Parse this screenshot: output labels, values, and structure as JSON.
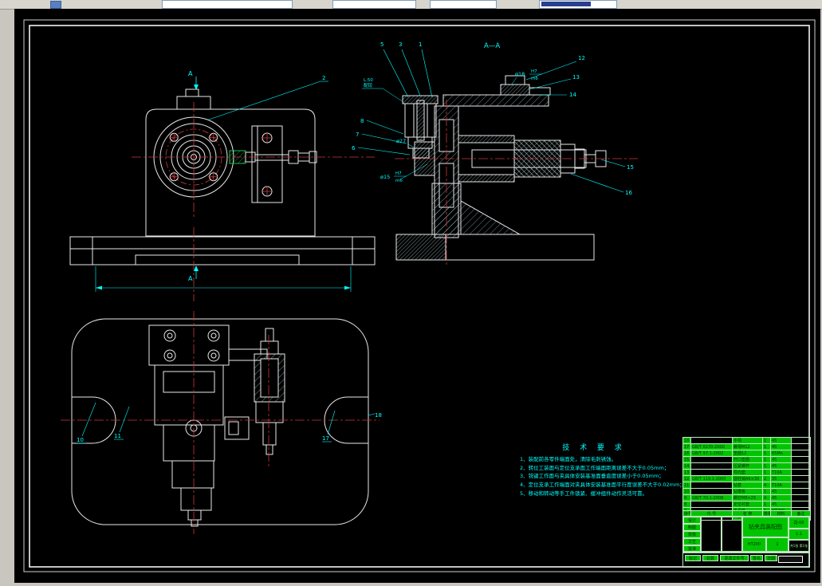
{
  "toolbar": {
    "combos": [
      "",
      "",
      "",
      ""
    ]
  },
  "drawing": {
    "section_label": "A—A",
    "cut_arrow": "A",
    "dims": {
      "d18": "ø18",
      "d18_fit_top": "H7",
      "d18_fit_bot": "m6",
      "d27": "ø27",
      "d15": "ø15",
      "d15_fit_top": "H7",
      "d15_fit_bot": "m6",
      "note_line1": "L:50",
      "note_line2": "配铰"
    },
    "balloons": {
      "b1": "1",
      "b2": "2",
      "b3": "3",
      "b5": "5",
      "b6": "6",
      "b7": "7",
      "b8": "8",
      "b10": "10",
      "b11": "11",
      "b12": "12",
      "b13": "13",
      "b14": "14",
      "b15": "15",
      "b16": "16",
      "b17": "17",
      "b18": "18"
    },
    "tech_req": {
      "title": "技 术 要 求",
      "items": [
        "1、装配前各零件端面处，清除毛刺锈蚀。",
        "2、转位工装面与定位支承面工作端面距离误差不大于0.05mm；",
        "3、铣键工作面与夹具体安装基准面垂直度误差小于0.05mm；",
        "4、定位支承工作端面对夹具体安装基准面平行度误差不大于0.02mm；",
        "5、移动和转动等手工件锁紧、缓冲组件动作灵活可靠。"
      ]
    }
  },
  "title_block": {
    "bom_headers": [
      "序号",
      "代  号",
      "名  称",
      "数量",
      "材料",
      "备注"
    ],
    "bom_rows": [
      {
        "no": "18",
        "code": "",
        "name": "手柄",
        "qty": "1",
        "mat": "45",
        "rem": ""
      },
      {
        "no": "17",
        "code": "GB/T 6170-2000",
        "name": "螺母M12",
        "qty": "1",
        "mat": "45",
        "rem": ""
      },
      {
        "no": "16",
        "code": "GB/T 97.1-2002",
        "name": "垫圈12",
        "qty": "1",
        "mat": "65Mn",
        "rem": ""
      },
      {
        "no": "15",
        "code": "",
        "name": "开口垫圈",
        "qty": "1",
        "mat": "45",
        "rem": ""
      },
      {
        "no": "14",
        "code": "",
        "name": "压紧螺杆",
        "qty": "1",
        "mat": "45",
        "rem": ""
      },
      {
        "no": "13",
        "code": "",
        "name": "导向套",
        "qty": "1",
        "mat": "T10A",
        "rem": ""
      },
      {
        "no": "12",
        "code": "GB/T 119.1-2000",
        "name": "圆柱销A6×30",
        "qty": "2",
        "mat": "35",
        "rem": ""
      },
      {
        "no": "11",
        "code": "",
        "name": "钻套",
        "qty": "4",
        "mat": "T10A",
        "rem": ""
      },
      {
        "no": "10",
        "code": "",
        "name": "钻模板",
        "qty": "1",
        "mat": "45",
        "rem": ""
      },
      {
        "no": "9",
        "code": "GB/T 70.1-2008",
        "name": "螺钉M8×25",
        "qty": "4",
        "mat": "45",
        "rem": ""
      },
      {
        "no": "8",
        "code": "",
        "name": "定位衬套",
        "qty": "1",
        "mat": "45",
        "rem": ""
      },
      {
        "no": "7",
        "code": "",
        "name": "支承座",
        "qty": "1",
        "mat": "HT200",
        "rem": ""
      },
      {
        "no": "6",
        "code": "",
        "name": "夹具体",
        "qty": "1",
        "mat": "HT200",
        "rem": ""
      }
    ],
    "main": {
      "title": "钻夹具装配图",
      "drawing_no": "ZJ-00",
      "material": "HT200",
      "scale": "1:1",
      "qty": "1",
      "sheet": "共1张 第1张"
    },
    "sig_rows": [
      "设计",
      "制图",
      "校核",
      "工艺",
      "批准"
    ],
    "bottom_cells": [
      "标记",
      "处数",
      "更改文件号",
      "签名",
      "日期"
    ]
  }
}
